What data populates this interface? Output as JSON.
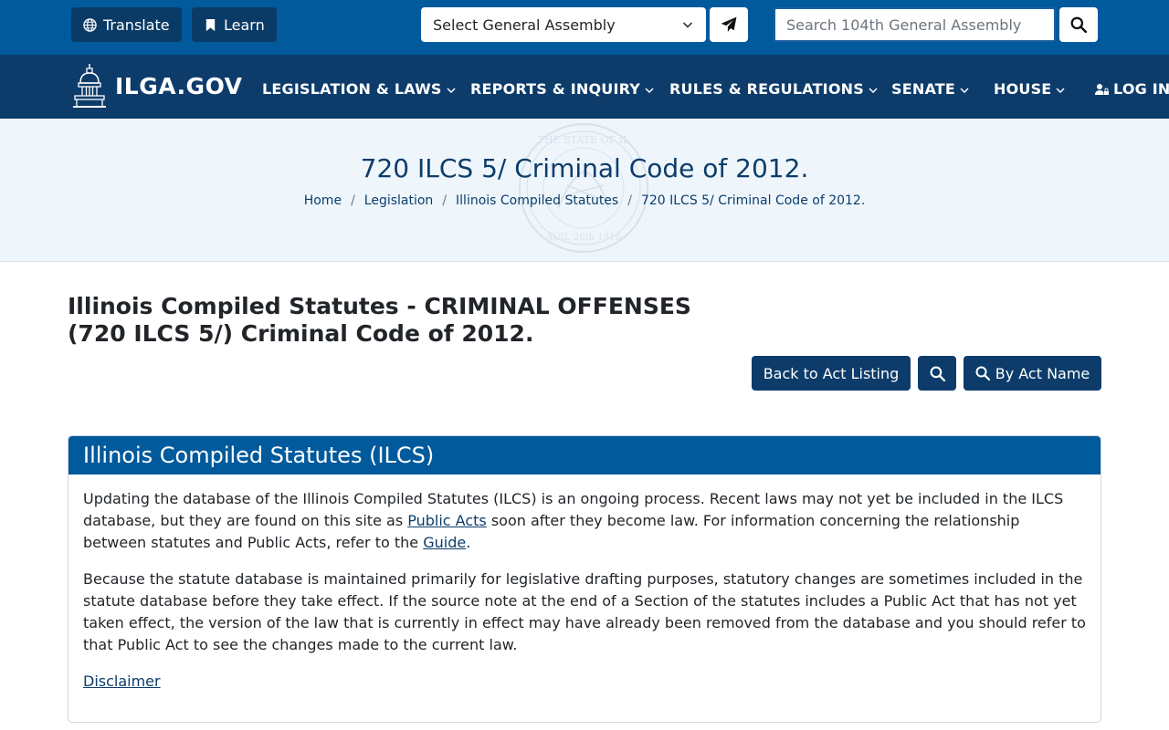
{
  "utility": {
    "translate_label": "Translate",
    "learn_label": "Learn",
    "ga_select_value": "Select General Assembly",
    "search_placeholder": "Search 104th General Assembly"
  },
  "nav": {
    "logo_text": "ILGA.GOV",
    "items": [
      {
        "label": "LEGISLATION & LAWS"
      },
      {
        "label": "REPORTS & INQUIRY"
      },
      {
        "label": "RULES & REGULATIONS"
      },
      {
        "label": "SENATE"
      },
      {
        "label": "HOUSE"
      }
    ],
    "login_label": "LOG IN"
  },
  "hero": {
    "title": "720 ILCS 5/ Criminal Code of 2012.",
    "breadcrumbs": [
      "Home",
      "Legislation",
      "Illinois Compiled Statutes",
      "720 ILCS 5/ Criminal Code of 2012."
    ],
    "seal_lines": [
      "THE STATE OF IL",
      "AUG. 26th 1818"
    ]
  },
  "main": {
    "heading_line1": "Illinois Compiled Statutes - CRIMINAL OFFENSES",
    "heading_line2": "(720 ILCS 5/) Criminal Code of 2012.",
    "back_label": "Back to Act Listing",
    "by_act_name_label": "By Act Name"
  },
  "card": {
    "title": "Illinois Compiled Statutes (ILCS)",
    "p1_a": "Updating the database of the Illinois Compiled Statutes (ILCS) is an ongoing process. Recent laws may not yet be included in the ILCS database, but they are found on this site as ",
    "p1_link1": "Public Acts",
    "p1_b": " soon after they become law. For information concerning the relationship between statutes and Public Acts, refer to the ",
    "p1_link2": "Guide",
    "p1_c": ".",
    "p2": "Because the statute database is maintained primarily for legislative drafting purposes, statutory changes are sometimes included in the statute database before they take effect. If the source note at the end of a Section of the statutes includes a Public Act that has not yet taken effect, the version of the law that is currently in effect may have already been removed from the database and you should refer to that Public Act to see the changes made to the current law.",
    "disclaimer": "Disclaimer"
  },
  "colors": {
    "util_bar": "#005a9c",
    "nav_bar": "#0d3c6b",
    "hero_bg": "#eef6fc",
    "card_header": "#005a9c"
  }
}
